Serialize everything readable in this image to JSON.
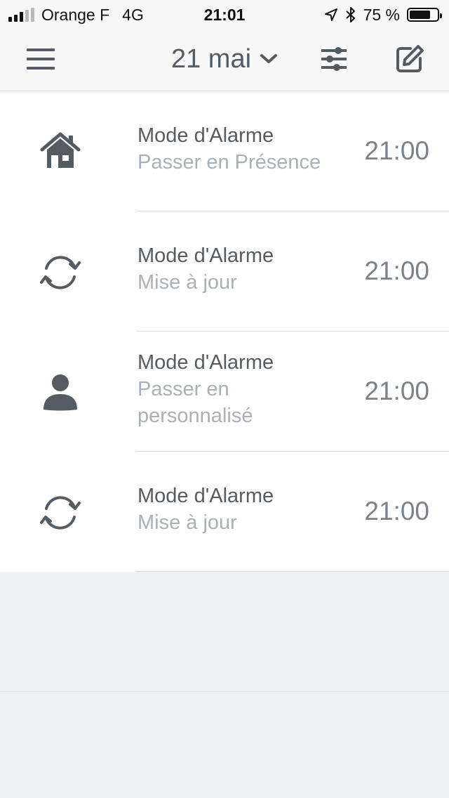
{
  "status_bar": {
    "carrier": "Orange F",
    "network": "4G",
    "time": "21:01",
    "battery": "75 %",
    "battery_level": 0.75
  },
  "nav": {
    "title": "21 mai",
    "menu_icon": "hamburger-menu-icon",
    "filter_icon": "sliders-icon",
    "edit_icon": "edit-square-icon"
  },
  "events": [
    {
      "icon": "house-icon",
      "title": "Mode d'Alarme",
      "subtitle_line1": "Passer en Présence",
      "subtitle_line2": "",
      "time": "21:00"
    },
    {
      "icon": "refresh-icon",
      "title": "Mode d'Alarme",
      "subtitle_line1": "Mise à jour",
      "subtitle_line2": "",
      "time": "21:00"
    },
    {
      "icon": "person-icon",
      "title": "Mode d'Alarme",
      "subtitle_line1": "Passer en",
      "subtitle_line2": "personnalisé",
      "time": "21:00"
    },
    {
      "icon": "refresh-icon",
      "title": "Mode d'Alarme",
      "subtitle_line1": "Mise à jour",
      "subtitle_line2": "",
      "time": "21:00"
    }
  ],
  "colors": {
    "icon": "#555b63",
    "subtitle": "#a9b0b7",
    "background": "#eff0f2"
  }
}
